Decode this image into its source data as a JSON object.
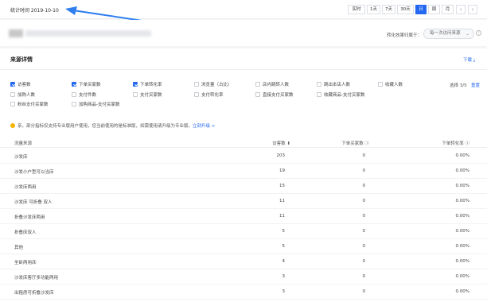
{
  "topbar": {
    "stat_time": "统计时间 2019-10-10",
    "ranges": [
      "实时",
      "1天",
      "7天",
      "30天",
      "日",
      "周",
      "月"
    ],
    "active_range": "日",
    "prev_icon": "chevron-left-icon",
    "next_icon": "chevron-right-icon"
  },
  "header": {
    "conversion_label": "转化效果归属于：",
    "conversion_value": "每一次访问来源",
    "help_icon": "help-circle-icon"
  },
  "section": {
    "title": "来源详情",
    "download": "下载 ⤓",
    "selected_count": "选择 3/5",
    "reset": "重置"
  },
  "metrics": [
    {
      "label": "访客数",
      "checked": true
    },
    {
      "label": "下单买家数",
      "checked": true
    },
    {
      "label": "下单转化率",
      "checked": true
    },
    {
      "label": "浏览量（占比）",
      "checked": false
    },
    {
      "label": "店内跳转人数",
      "checked": false
    },
    {
      "label": "跳出本店人数",
      "checked": false
    },
    {
      "label": "收藏人数",
      "checked": false
    },
    {
      "label": "加购人数",
      "checked": false
    },
    {
      "label": "支付件数",
      "checked": false
    },
    {
      "label": "支付买家数",
      "checked": false
    },
    {
      "label": "支付转化率",
      "checked": false
    },
    {
      "label": "直接支付买家数",
      "checked": false
    },
    {
      "label": "收藏商品-支付买家数",
      "checked": false
    },
    {
      "label": "粉丝支付买家数",
      "checked": false
    },
    {
      "label": "加购商品-支付买家数",
      "checked": false
    }
  ],
  "notice": {
    "text": "亲，部分指标仅支持专业版用户使用，您当前使用的是标准版，如需使用请升级为专业版。",
    "link": "立刻升级 >"
  },
  "table": {
    "headers": [
      "流量来源",
      "访客数 ⬇",
      "下单买家数 ⓘ",
      "下单转化率 ⓘ"
    ],
    "rows": [
      [
        "沙发床",
        "203",
        "0",
        "0.00%"
      ],
      [
        "沙发小户型可以当床",
        "19",
        "0",
        "0.00%"
      ],
      [
        "沙发床两用",
        "15",
        "0",
        "0.00%"
      ],
      [
        "沙发床 可折叠 双人",
        "11",
        "0",
        "0.00%"
      ],
      [
        "折叠沙发床两用",
        "11",
        "0",
        "0.00%"
      ],
      [
        "折叠床双人",
        "5",
        "0",
        "0.00%"
      ],
      [
        "其他",
        "5",
        "0",
        "0.00%"
      ],
      [
        "坐卧两用床",
        "4",
        "0",
        "0.00%"
      ],
      [
        "沙发床客厅多功能两用",
        "3",
        "0",
        "0.00%"
      ],
      [
        "出租房可折叠沙发床",
        "3",
        "0",
        "0.00%"
      ]
    ]
  }
}
